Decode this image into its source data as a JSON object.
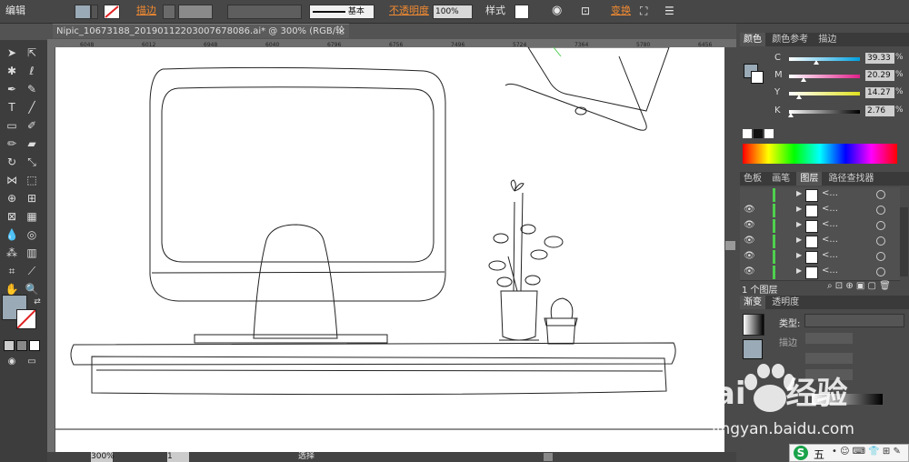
{
  "menu": {
    "edit_label": "编辑"
  },
  "control_bar": {
    "stroke_label": "描边",
    "stroke_profile": "基本",
    "opacity_label": "不透明度",
    "opacity_value": "100%",
    "style_label": "样式",
    "transform_label": "变换"
  },
  "document": {
    "tab_title": "Nipic_10673188_20190112203007678086.ai* @ 300% (RGB/轮廓)",
    "close_glyph": "×",
    "ruler_marks": [
      "6048",
      "6012",
      "6948",
      "6040",
      "6796",
      "6756",
      "7496",
      "5724",
      "7364",
      "5780",
      "6456"
    ]
  },
  "status_bar": {
    "zoom_value": "300%",
    "page_value": "1",
    "mode_label": "选择"
  },
  "color_panel": {
    "tabs": [
      "颜色",
      "颜色参考",
      "描边"
    ],
    "sliders": [
      {
        "label": "C",
        "value": "39.33",
        "unit": "%",
        "position": 0.39
      },
      {
        "label": "M",
        "value": "20.29",
        "unit": "%",
        "position": 0.2
      },
      {
        "label": "Y",
        "value": "14.27",
        "unit": "%",
        "position": 0.14
      },
      {
        "label": "K",
        "value": "2.76",
        "unit": "%",
        "position": 0.03
      }
    ]
  },
  "layers_panel": {
    "tabs": [
      "色板",
      "画笔",
      "图层",
      "路径查找器"
    ],
    "rows": [
      {
        "name": "<..."
      },
      {
        "name": "<..."
      },
      {
        "name": "<..."
      },
      {
        "name": "<..."
      },
      {
        "name": "<..."
      },
      {
        "name": "<..."
      }
    ],
    "footer_label": "1 个图层"
  },
  "gradient_panel": {
    "tabs": [
      "渐变",
      "透明度"
    ],
    "type_label": "类型:",
    "stroke_label": "描边"
  },
  "watermark": {
    "brand_text": "Bai",
    "brand_text2": "经验",
    "url": "jingyan.baidu.com"
  },
  "ime_bar": {
    "logo": "S",
    "mode_text": "五"
  },
  "colors": {
    "fill_swatch": "#9aaab6",
    "accent_orange": "#f08a32",
    "layer_green": "#4fd04f"
  }
}
